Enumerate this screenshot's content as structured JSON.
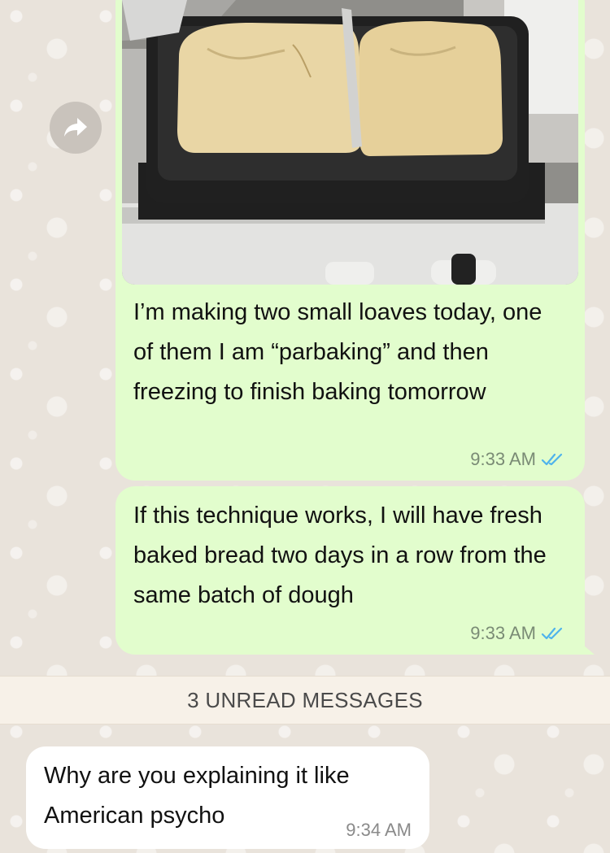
{
  "messages": [
    {
      "direction": "outgoing",
      "has_photo": true,
      "photo_icon": "bread-loaves-photo",
      "text": "I’m making two small loaves today, one of them I am “parbaking” and then freezing to finish baking tomorrow",
      "time": "9:33 AM",
      "status_icon": "double-check-icon"
    },
    {
      "direction": "outgoing",
      "text": "If this technique works, I will have fresh baked bread two days in a row from the same batch of dough",
      "time": "9:33 AM",
      "status_icon": "double-check-icon"
    },
    {
      "direction": "incoming",
      "text": "Why are you explaining it like American psycho",
      "time": "9:34 AM"
    }
  ],
  "unread_divider": "3 UNREAD MESSAGES",
  "colors": {
    "outgoing_bubble": "#e2fdcd",
    "incoming_bubble": "#ffffff",
    "read_ticks": "#4fb3ec",
    "wallpaper": "#e9e3db"
  }
}
